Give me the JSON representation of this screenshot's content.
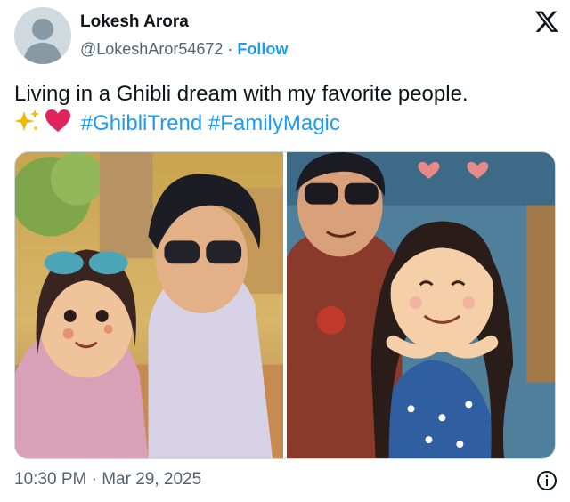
{
  "tweet": {
    "author": {
      "name": "Lokesh Arora",
      "handle": "@LokeshAror54672",
      "separator": " · ",
      "follow_label": "Follow"
    },
    "text_line1": "Living in a Ghibli dream with my favorite people.",
    "emojis": [
      "sparkles-icon",
      "red-heart-icon"
    ],
    "hashtags": [
      "#GhibliTrend",
      "#FamilyMagic"
    ],
    "timestamp": "10:30 PM · Mar 29, 2025",
    "media": [
      {
        "icon": "ghibli-selfie-image",
        "scene": "girl and man with holi colors"
      },
      {
        "icon": "ghibli-hug-image",
        "scene": "father and smiling daughter"
      }
    ]
  },
  "colors": {
    "accent": "#1d9bf0",
    "text": "#0f1419",
    "secondary": "#536471",
    "heart": "#e0245e"
  }
}
